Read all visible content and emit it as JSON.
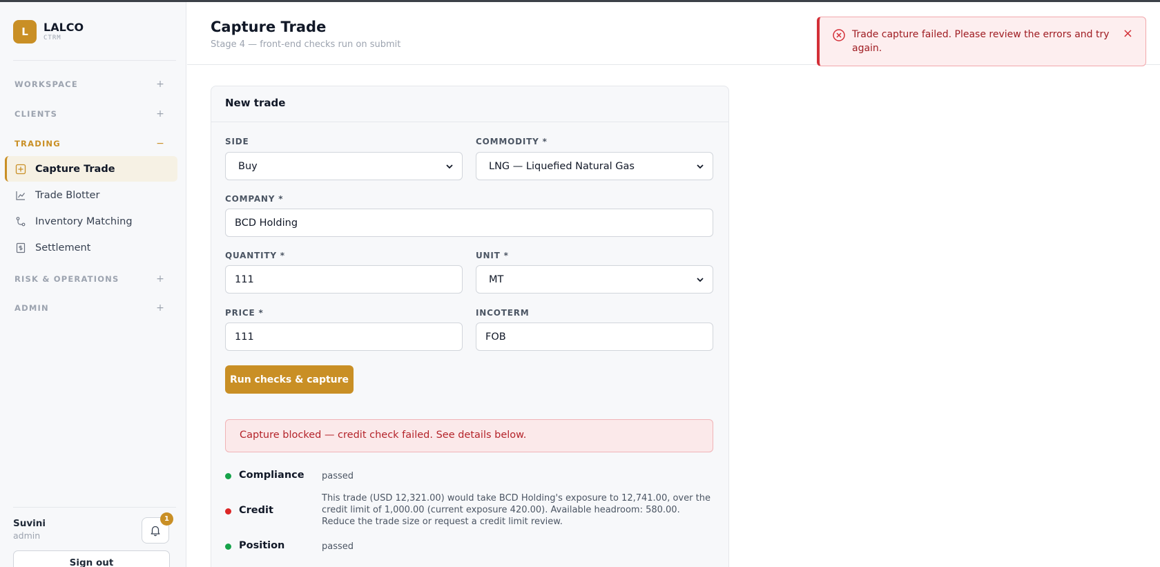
{
  "brand": {
    "logo_letter": "L",
    "name": "LALCO",
    "sub": "CTRM"
  },
  "sidebar": {
    "sections": [
      {
        "label": "WORKSPACE",
        "toggle": "+"
      },
      {
        "label": "CLIENTS",
        "toggle": "+"
      },
      {
        "label": "TRADING",
        "toggle": "−"
      },
      {
        "label": "RISK & OPERATIONS",
        "toggle": "+"
      },
      {
        "label": "ADMIN",
        "toggle": "+"
      }
    ],
    "trading_items": [
      {
        "label": "Capture Trade",
        "icon": "plus-square-icon",
        "active": true
      },
      {
        "label": "Trade Blotter",
        "icon": "line-chart-icon"
      },
      {
        "label": "Inventory Matching",
        "icon": "git-merge-icon"
      },
      {
        "label": "Settlement",
        "icon": "receipt-icon"
      }
    ],
    "accent_color": "#c98f25"
  },
  "user": {
    "name": "Suvini",
    "role": "admin",
    "notifications": "1",
    "sign_out": "Sign out"
  },
  "header": {
    "title": "Capture Trade",
    "subtitle": "Stage 4 — front-end checks run on submit"
  },
  "toast": {
    "message": "Trade capture failed. Please review the errors and try again.",
    "close": "×",
    "color": "#d32f37"
  },
  "form": {
    "card_title": "New trade",
    "side": {
      "label": "SIDE",
      "value": "Buy"
    },
    "commodity": {
      "label": "COMMODITY *",
      "value": "LNG — Liquefied Natural Gas"
    },
    "company": {
      "label": "COMPANY *",
      "value": "BCD Holding"
    },
    "quantity": {
      "label": "QUANTITY *",
      "value": "111"
    },
    "unit": {
      "label": "UNIT *",
      "value": "MT"
    },
    "price": {
      "label": "PRICE *",
      "value": "111"
    },
    "incoterm": {
      "label": "INCOTERM",
      "value": "FOB"
    },
    "submit": "Run checks & capture"
  },
  "alert": {
    "message": "Capture blocked — credit check failed. See details below."
  },
  "checks": [
    {
      "name": "Compliance",
      "status": "ok",
      "detail": "passed"
    },
    {
      "name": "Credit",
      "status": "fail",
      "detail": "This trade (USD 12,321.00) would take BCD Holding's exposure to 12,741.00, over the credit limit of 1,000.00 (current exposure 420.00). Available headroom: 580.00. Reduce the trade size or request a credit limit review."
    },
    {
      "name": "Position",
      "status": "ok",
      "detail": "passed"
    }
  ]
}
